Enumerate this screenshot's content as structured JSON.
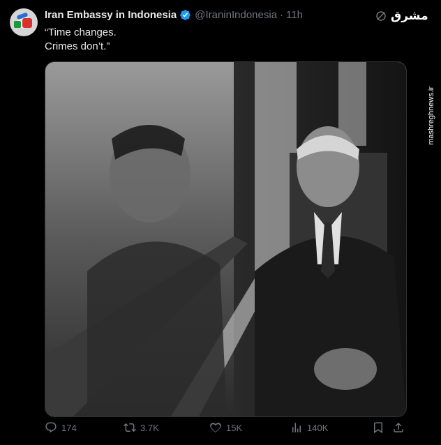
{
  "tweet": {
    "author_name": "Iran Embassy in Indonesia",
    "handle": "@IraninIndonesia",
    "separator": "·",
    "time": "11h",
    "text_lines": [
      "“Time changes.",
      "Crimes don’t.”"
    ],
    "verified_color": "#1d9bf0"
  },
  "overlay": {
    "logo_text": "مشرق",
    "watermark": "mashreghnews.ir"
  },
  "actions": {
    "replies": "174",
    "reposts": "3.7K",
    "likes": "15K",
    "views": "140K"
  },
  "colors": {
    "background": "#000000",
    "text": "#e7e9ea",
    "muted": "#71767b"
  }
}
